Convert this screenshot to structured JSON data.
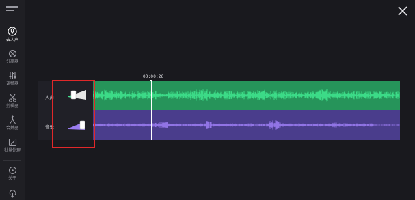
{
  "sidebar": {
    "items": [
      {
        "label": "去人声",
        "icon": "remove-vocal-icon",
        "active": true
      },
      {
        "label": "分离器",
        "icon": "separator-icon",
        "active": false
      },
      {
        "label": "调频器",
        "icon": "equalizer-icon",
        "active": false
      },
      {
        "label": "剪辑器",
        "icon": "scissors-icon",
        "active": false
      },
      {
        "label": "合并器",
        "icon": "merge-icon",
        "active": false
      },
      {
        "label": "批量处理",
        "icon": "batch-edit-icon",
        "active": false
      },
      {
        "label": "关于",
        "icon": "info-icon",
        "active": false
      }
    ]
  },
  "timeline": {
    "timecode": "00:00:26",
    "playhead_fraction": 0.19
  },
  "tracks": [
    {
      "label": "人声",
      "color": "#26945a",
      "wave_color": "#3fe38d",
      "volume_fraction": 0.15
    },
    {
      "label": "音乐",
      "color": "#4a3d8c",
      "wave_color": "#9a7cf0",
      "volume_fraction": 0.9
    }
  ],
  "colors": {
    "background": "#19191e",
    "highlight": "#e0282a"
  }
}
